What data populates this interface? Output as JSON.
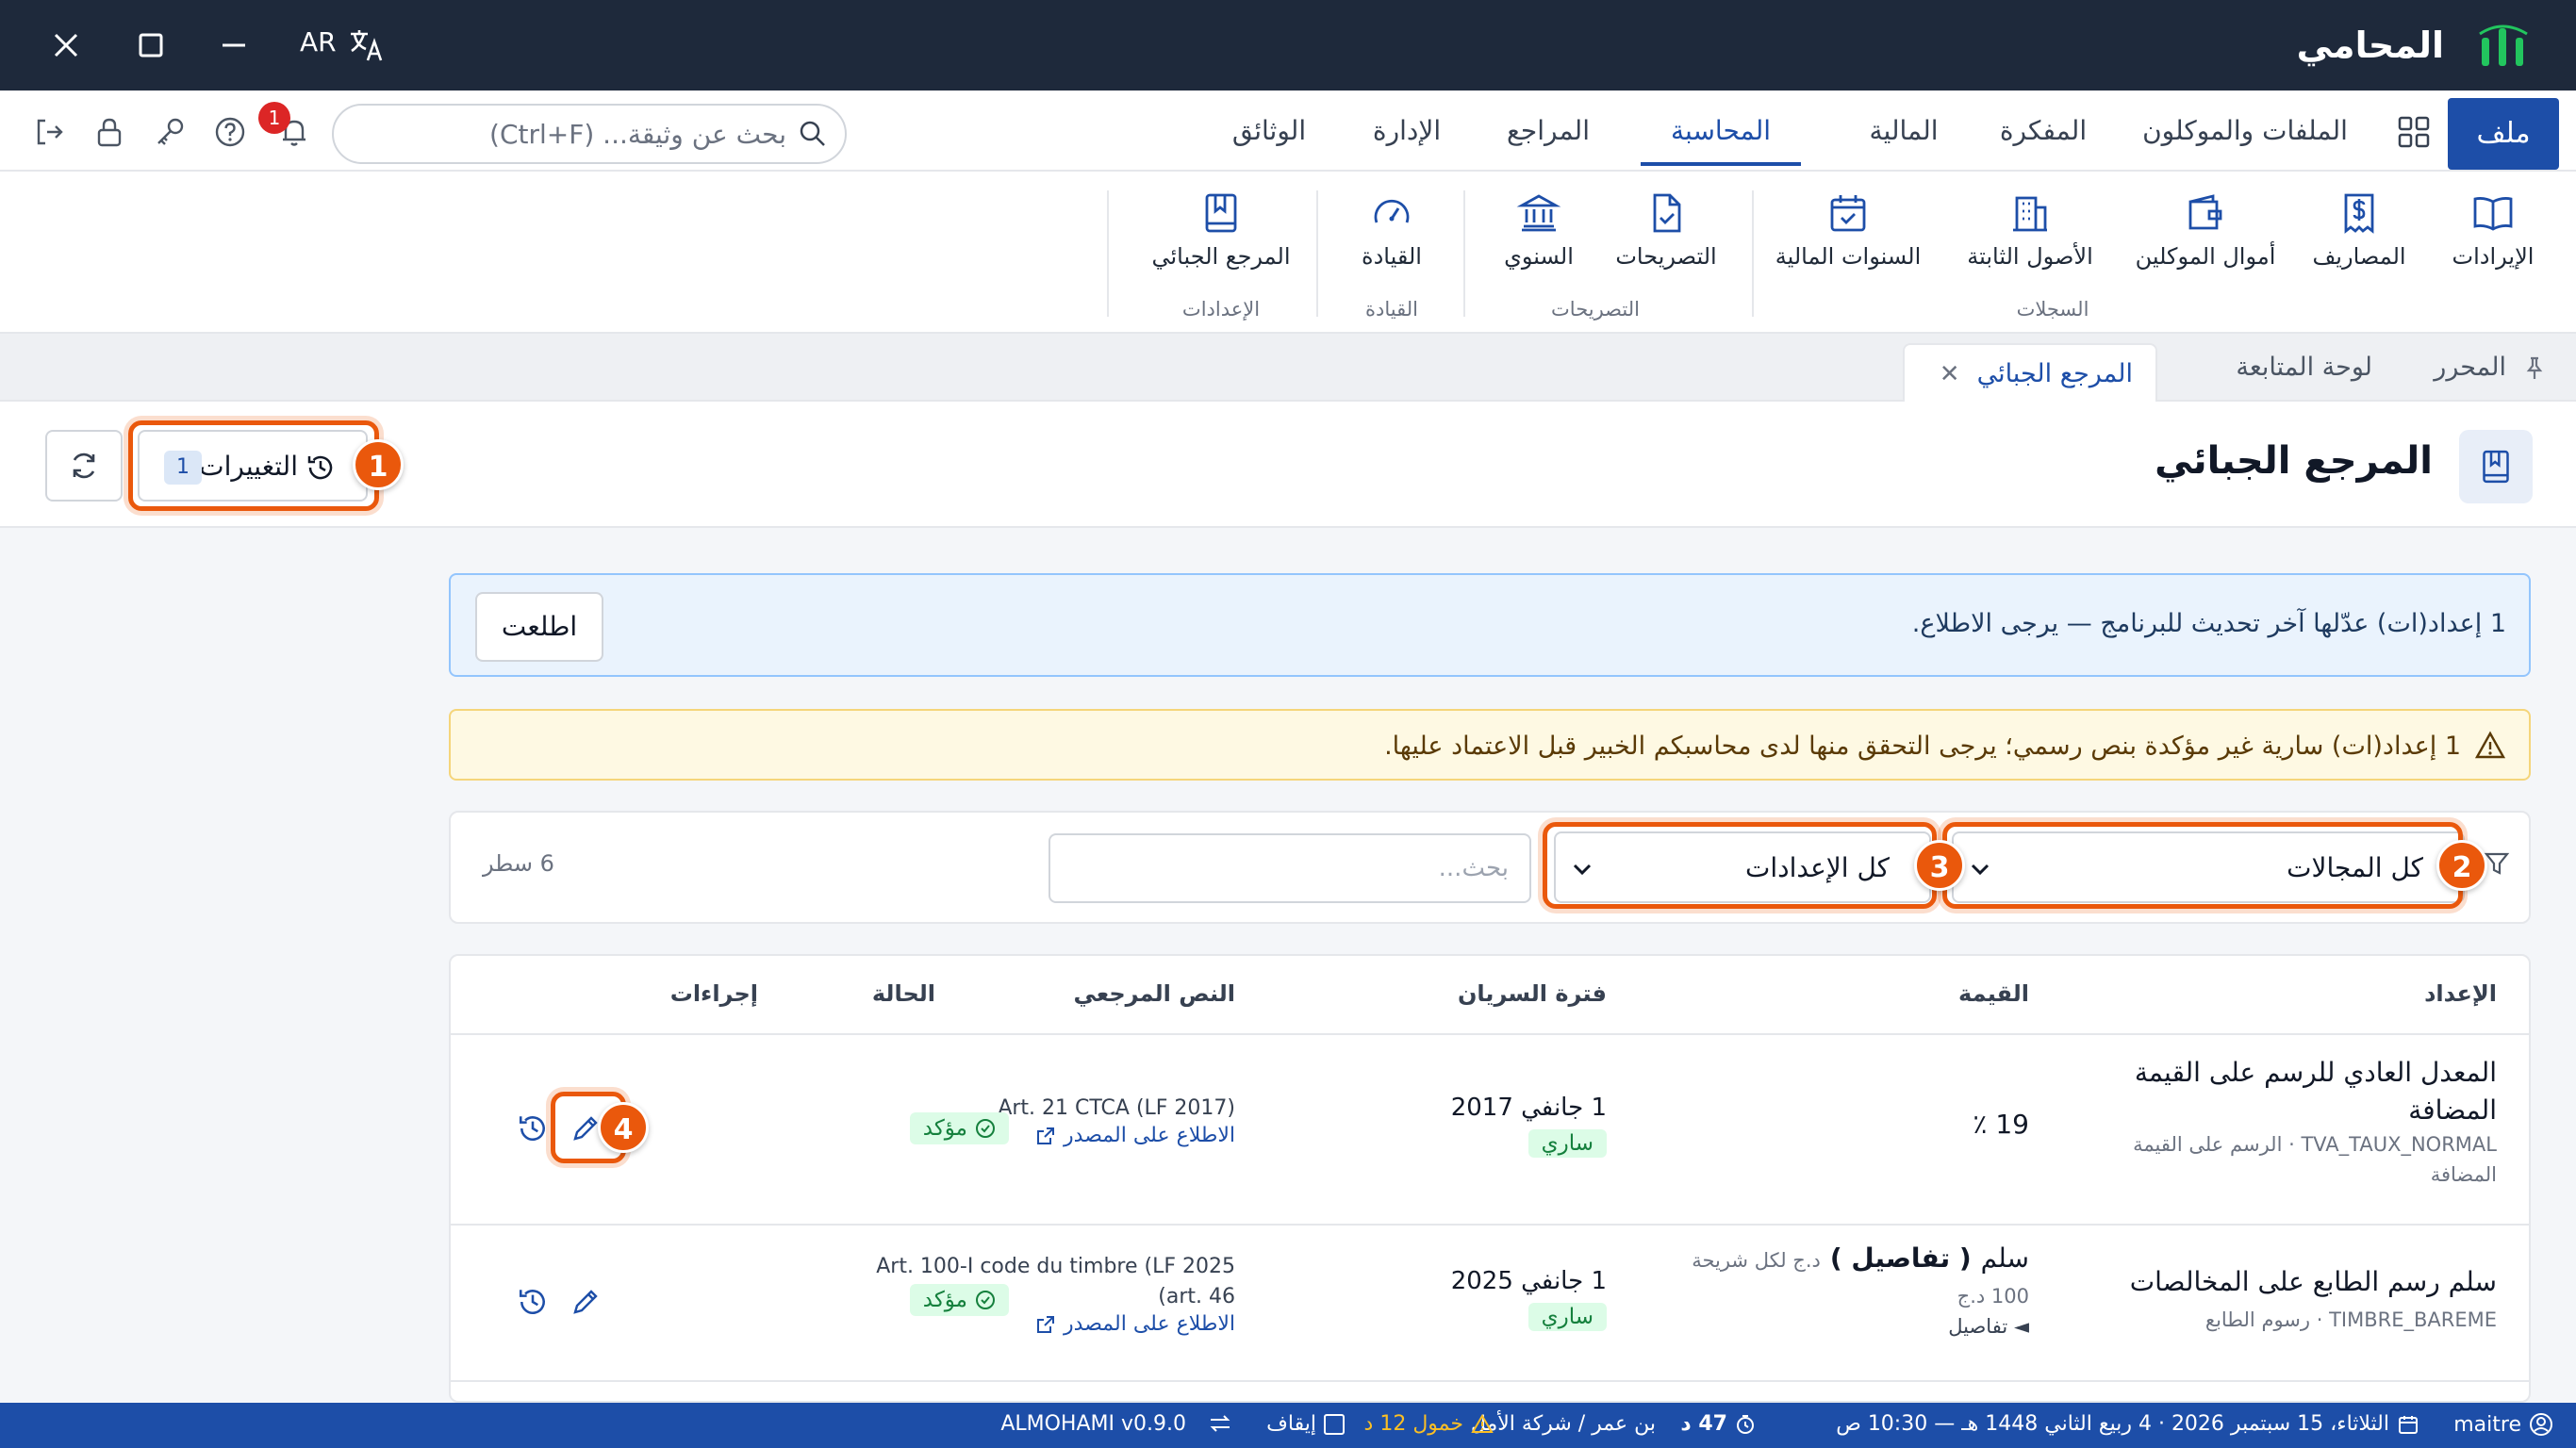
{
  "titlebar": {
    "app_title": "المحامي",
    "lang": "AR"
  },
  "menu": {
    "file": "ملف",
    "tabs": [
      "الملفات والموكلون",
      "المفكرة",
      "المالية",
      "المحاسبة",
      "المراجع",
      "الإدارة",
      "الوثائق"
    ],
    "active_tab": "المحاسبة",
    "search_placeholder": "بحث عن وثيقة... (Ctrl+F)",
    "notification_count": "1"
  },
  "ribbon": {
    "buttons": [
      {
        "label": "الإيرادات",
        "icon": "book-open-icon"
      },
      {
        "label": "المصاريف",
        "icon": "receipt-dollar-icon"
      },
      {
        "label": "أموال الموكلين",
        "icon": "wallet-icon"
      },
      {
        "label": "الأصول الثابتة",
        "icon": "building-icon"
      },
      {
        "label": "السنوات المالية",
        "icon": "calendar-check-icon"
      },
      {
        "label": "التصريحات",
        "icon": "file-check-icon"
      },
      {
        "label": "السنوي",
        "icon": "bank-icon"
      },
      {
        "label": "القيادة",
        "icon": "gauge-icon"
      },
      {
        "label": "المرجع الجبائي",
        "icon": "book-bookmark-icon"
      }
    ],
    "groups": [
      "السجلات",
      "التصريحات",
      "القيادة",
      "الإعدادات"
    ]
  },
  "doc_tabs": {
    "editor": "المحرر",
    "dashboard": "لوحة المتابعة",
    "active": "المرجع الجبائي"
  },
  "page": {
    "title": "المرجع الجبائي",
    "changes_label": "التغييرات",
    "changes_count": "1"
  },
  "annotations": [
    "1",
    "2",
    "3",
    "4"
  ],
  "info_banner": {
    "text": "1 إعداد(ات) عدّلها آخر تحديث للبرنامج — يرجى الاطلاع.",
    "button": "اطلعت"
  },
  "warning_banner": {
    "text": "1 إعداد(ات) سارية غير مؤكدة بنص رسمي؛ يرجى التحقق منها لدى محاسبكم الخبير قبل الاعتماد عليها."
  },
  "filters": {
    "domain": "كل المجالات",
    "setting": "كل الإعدادات",
    "search_placeholder": "بحث...",
    "row_count": "6 سطر"
  },
  "table": {
    "headers": [
      "الإعداد",
      "القيمة",
      "فترة السريان",
      "النص المرجعي",
      "الحالة",
      "إجراءات"
    ],
    "rows": [
      {
        "name_line1": "المعدل العادي للرسم على القيمة",
        "name_line2": "المضافة",
        "code": "TVA_TAUX_NORMAL · الرسم على القيمة",
        "category_cont": "المضافة",
        "value": "19 ٪",
        "date": "1 جانفي 2017",
        "validity": "ساري",
        "ref": "Art. 21 CTCA (LF 2017)",
        "link": "الاطلاع على المصدر",
        "status": "مؤكد"
      },
      {
        "name_line1": "سلم رسم الطابع على المخالصات",
        "code": "TIMBRE_BAREME · رسوم الطابع",
        "value_main": "سلم",
        "value_detail": "( تفاصيل )",
        "value_unit": "د.ج لكل شريحة",
        "value_sub": "100 د.ج",
        "details_toggle": "◄ تفاصيل",
        "date": "1 جانفي 2025",
        "validity": "ساري",
        "ref_line1": "Art. 100-I code du timbre (LF 2025",
        "ref_line2": "art. 46)",
        "link": "الاطلاع على المصدر",
        "status": "مؤكد"
      }
    ]
  },
  "statusbar": {
    "user": "maitre",
    "date": "الثلاثاء، 15 سبتمبر 2026 · 4 ربيع الثاني 1448 هـ — 10:30 ص",
    "timer": "47 د",
    "client": "بن عمر / شركة الأمل",
    "idle": "خمول 12 د",
    "pause": "إيقاف",
    "version": "ALMOHAMI v0.9.0"
  },
  "colors": {
    "titlebar": "#1e293b",
    "accent": "#1d4ea8",
    "highlight": "#ea580c",
    "success": "#15803d"
  }
}
